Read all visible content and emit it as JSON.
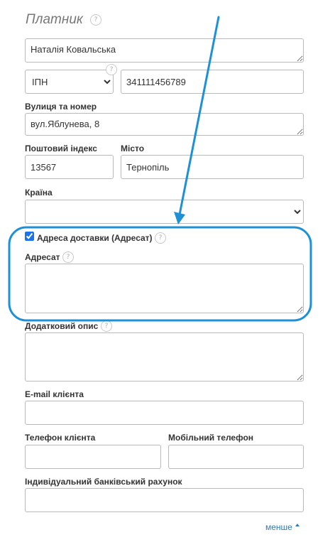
{
  "payer": {
    "title": "Платник",
    "help": "?",
    "name_value": "Наталія Ковальська",
    "id_type_selected": "ІПН",
    "id_value": "341111456789",
    "street_label": "Вулиця та номер",
    "street_value": "вул.Яблунева, 8",
    "postal_label": "Поштовий індекс",
    "postal_value": "13567",
    "city_label": "Місто",
    "city_value": "Тернопіль",
    "country_label": "Країна",
    "country_value": ""
  },
  "delivery": {
    "checkbox_label": "Адреса доставки (Адресат)",
    "recipient_label": "Адресат",
    "recipient_value": ""
  },
  "extra": {
    "description_label": "Додатковий опис",
    "email_label": "E-mail клієнта",
    "phone_label": "Телефон клієнта",
    "mobile_label": "Мобільний телефон",
    "iban_label": "Індивідуальний банківський рахунок"
  },
  "footer": {
    "less_label": "менше"
  },
  "colors": {
    "annotation": "#1e90d8",
    "link": "#337ab7"
  }
}
